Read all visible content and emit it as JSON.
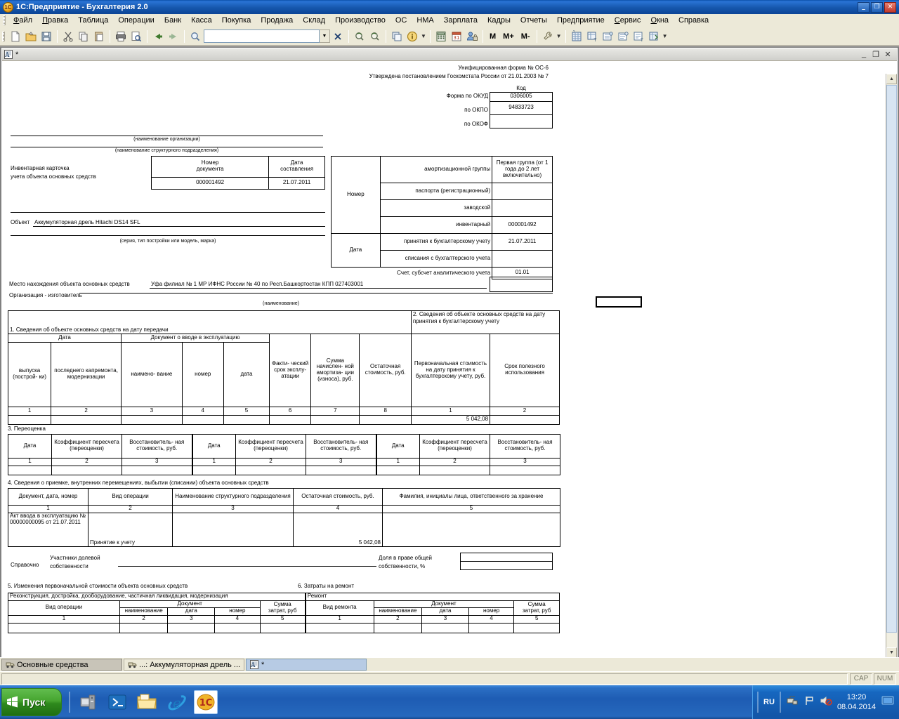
{
  "window": {
    "title": "1С:Предприятие - Бухгалтерия 2.0",
    "app_icon": "1c-logo-icon",
    "minimize": "_",
    "maximize": "❐",
    "close": "✕"
  },
  "menu": {
    "items": [
      {
        "label": "Файл",
        "accel": "Ф"
      },
      {
        "label": "Правка",
        "accel": "П"
      },
      {
        "label": "Таблица"
      },
      {
        "label": "Операции"
      },
      {
        "label": "Банк"
      },
      {
        "label": "Касса"
      },
      {
        "label": "Покупка"
      },
      {
        "label": "Продажа"
      },
      {
        "label": "Склад"
      },
      {
        "label": "Производство"
      },
      {
        "label": "ОС"
      },
      {
        "label": "НМА"
      },
      {
        "label": "Зарплата"
      },
      {
        "label": "Кадры"
      },
      {
        "label": "Отчеты"
      },
      {
        "label": "Предприятие"
      },
      {
        "label": "Сервис",
        "accel": "С"
      },
      {
        "label": "Окна",
        "accel": "О"
      },
      {
        "label": "Справка"
      }
    ]
  },
  "toolbar": {
    "search_value": "",
    "search_placeholder": "",
    "memory_buttons": [
      "M",
      "M+",
      "M-"
    ],
    "icons": [
      "new-document-icon",
      "open-folder-icon",
      "save-icon",
      "cut-scissors-icon",
      "copy-icon",
      "paste-icon",
      "print-icon",
      "print-preview-icon",
      "undo-arrow-icon",
      "redo-arrow-icon",
      "find-magnifier-icon",
      "dropdown-arrow-icon",
      "clear-x-icon",
      "find-next-icon",
      "find-prev-icon",
      "copy-window-icon",
      "info-icon",
      "calculator-icon",
      "calendar-icon",
      "user-settings-icon",
      "wrench-icon",
      "report-table-icon",
      "report-group-icon",
      "report-struct-icon",
      "report-list-icon",
      "report-text-icon",
      "report-export-icon"
    ]
  },
  "document_window": {
    "icon": "spreadsheet-doc-icon",
    "title": "*",
    "minimize": "_",
    "restore": "❐",
    "close": "✕"
  },
  "form": {
    "header_lines": [
      "Унифицированная форма № ОС-6",
      "Утверждена постановлением Госкомстата России от 21.01.2003 № 7"
    ],
    "code_table": {
      "title": "Код",
      "rows": [
        {
          "label": "Форма по ОКУД",
          "value": "0306005"
        },
        {
          "label": "по ОКПО",
          "value": "94833723"
        },
        {
          "label": "по ОКОФ",
          "value": ""
        }
      ]
    },
    "org_caption": "(наименование организации)",
    "subdivision_caption": "(наименование структурного подразделения)",
    "card_title_line1": "Инвентарная карточка",
    "card_title_line2": "учета объекта основных средств",
    "doc_number_header_1": "Номер",
    "doc_number_header_2": "документа",
    "doc_date_header_1": "Дата",
    "doc_date_header_2": "составления",
    "doc_number_value": "000001492",
    "doc_date_value": "21.07.2011",
    "object_label": "Объект",
    "object_value": "Аккумуляторная дрель Hitachi DS14 SFL",
    "series_caption": "(серия, тип постройки или модель, марка)",
    "number_block": {
      "row_label_number": "Номер",
      "row_label_date": "Дата",
      "rows": [
        {
          "name": "амортизационной группы",
          "value": "Первая группа (от 1 года до 2 лет включительно)"
        },
        {
          "name": "паспорта (регистрационный)",
          "value": ""
        },
        {
          "name": "заводской",
          "value": ""
        },
        {
          "name": "инвентарный",
          "value": "000001492"
        },
        {
          "name": "принятия к бухгалтерскому учету",
          "value": "21.07.2011"
        },
        {
          "name": "списания с бухгалтерского учета",
          "value": ""
        }
      ],
      "account_label": "Счет, субсчет аналитического учета",
      "account_value": "01.01"
    },
    "location_label": "Место нахождения объекта основных средств",
    "location_value": "Уфа филиал № 1 МР ИФНС России № 40 по Респ.Башкортостан КПП 027403001",
    "manufacturer_label": "Организация - изготовитель",
    "manufacturer_value": "",
    "name_caption": "(наименование)",
    "section1_title": "1. Сведения об объекте основных средств на дату передачи",
    "section2_title": "2. Сведения об объекте основных средств на дату принятия к бухгалтерскому учету",
    "section12": {
      "group_date": "Дата",
      "group_doc": "Документ о вводе в эксплуатацию",
      "headers": [
        "выпуска (построй- ки)",
        "последнего капремонта, модернизации",
        "наимено- вание",
        "номер",
        "дата",
        "Факти- ческий срок эксплу- атации",
        "Сумма начислен- ной амортиза- ции (износа), руб.",
        "Остаточная стоимость, руб.",
        "Первоначальная стоимость на дату принятия к бухгалтерскому учету, руб.",
        "Срок полезного использования"
      ],
      "numbers": [
        "1",
        "2",
        "3",
        "4",
        "5",
        "6",
        "7",
        "8",
        "1",
        "2"
      ],
      "values": [
        "",
        "",
        "",
        "",
        "",
        "",
        "",
        "",
        "5 042,08",
        ""
      ]
    },
    "section3_title": "3. Переоценка",
    "section3": {
      "headers": [
        "Дата",
        "Коэффициент пересчета (переоценки)",
        "Восстановитель- ная стоимость, руб."
      ],
      "numbers": [
        "1",
        "2",
        "3"
      ],
      "groups": 3,
      "values": [
        "",
        "",
        ""
      ]
    },
    "section4_title": "4. Сведения о приемке, внутренних перемещениях, выбытии (списании) объекта основных средств",
    "section4": {
      "headers": [
        "Документ, дата, номер",
        "Вид операции",
        "Наименование структурного подразделения",
        "Остаточная стоимость, руб.",
        "Фамилия, инициалы лица, ответственного за хранение"
      ],
      "numbers": [
        "1",
        "2",
        "3",
        "4",
        "5"
      ],
      "rows": [
        [
          "Акт ввода в эксплуатацию № 00000000095 от 21.07.2011",
          "Принятие к учету",
          "",
          "5 042,08",
          ""
        ]
      ]
    },
    "reference": {
      "label": "Справочно",
      "participants_line1": "Участники долевой",
      "participants_line2": "собственности",
      "participants_value": "",
      "share_line1": "Доля в праве общей",
      "share_line2": "собственности, %",
      "share_value_1": "",
      "share_value_2": ""
    },
    "section5_title": "5. Изменения первоначальной стоимости объекта основных средств",
    "section6_title": "6. Затраты на ремонт",
    "section5": {
      "subtitle": "Реконструкция, достройка, дооборудование, частичная ликвидация, модернизация",
      "col1": "Вид операции",
      "group_doc": "Документ",
      "doc_cols": [
        "наименование",
        "дата",
        "номер"
      ],
      "sum_col_1": "Сумма",
      "sum_col_2": "затрат, руб",
      "numbers": [
        "1",
        "2",
        "3",
        "4",
        "5"
      ],
      "values": [
        "",
        "",
        "",
        "",
        ""
      ]
    },
    "section6": {
      "subtitle": "Ремонт",
      "col1": "Вид ремонта",
      "group_doc": "Документ",
      "doc_cols": [
        "наименование",
        "дата",
        "номер"
      ],
      "sum_col_1": "Сумма",
      "sum_col_2": "затрат, руб",
      "numbers": [
        "1",
        "2",
        "3",
        "4",
        "5"
      ],
      "values": [
        "",
        "",
        "",
        "",
        ""
      ]
    }
  },
  "window_list": [
    {
      "label": "Основные средства",
      "icon": "os-truck-icon",
      "state": "inactive"
    },
    {
      "label": "...: Аккумуляторная дрель ...",
      "icon": "os-truck-icon",
      "state": "inactive"
    },
    {
      "label": "*",
      "icon": "spreadsheet-doc-icon",
      "state": "active"
    }
  ],
  "status_bar": {
    "message": "",
    "cap": "CAP",
    "num": "NUM"
  },
  "taskbar": {
    "start_label": "Пуск",
    "quick_launch": [
      "computer-icon",
      "powershell-icon",
      "explorer-folder-icon",
      "internet-explorer-icon",
      "1c-enterprise-icon"
    ],
    "tray": {
      "language": "RU",
      "icons": [
        "network-icon",
        "flag-icon",
        "volume-muted-icon"
      ],
      "time": "13:20",
      "date": "08.04.2014",
      "show_desktop": "show-desktop-icon"
    }
  },
  "colors": {
    "title_blue": "#1657ad",
    "toolbar_bg": "#ece9d8",
    "taskbar_blue": "#1e5cb3",
    "start_green": "#46a52f",
    "active_tab": "#b7cbe4"
  }
}
